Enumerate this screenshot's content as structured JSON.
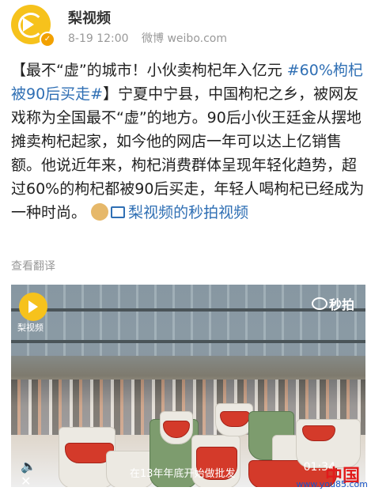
{
  "header": {
    "username": "梨视频",
    "date": "8-19 12:00",
    "source": "微博 weibo.com",
    "avatar_icon": "pear-video-logo-icon",
    "verified_icon": "verified-badge-icon"
  },
  "post": {
    "line1": "【最不“虚”的城市！小伙卖枸杞年入亿元",
    "hashtag": "#60%枸杞被90后买走#",
    "body": "】宁夏中宁县，中国枸杞之乡，被网友戏称为全国最不“虚”的地方。90后小伙王廷金从摆地摊卖枸杞起家，如今他的网店一年可以达上亿销售额。他说近年来，枸杞消费群体呈现年轻化趋势，超过60%的枸杞都被90后买走，年轻人喝枸杞已经成为一种时尚。",
    "link_label": "梨视频的秒拍视频",
    "link_icon": "video-icon"
  },
  "translate_label": "查看翻译",
  "video": {
    "brand": "梨视频",
    "miaopai": "秒拍",
    "caption": "在13年年底开始做批发",
    "time": "01:34",
    "mute_icon": "speaker-mute-icon"
  },
  "watermark": {
    "cn": "中国",
    "url": "www.you85.com"
  },
  "colors": {
    "link": "#2f6fb4",
    "logo": "#f6c21c"
  }
}
